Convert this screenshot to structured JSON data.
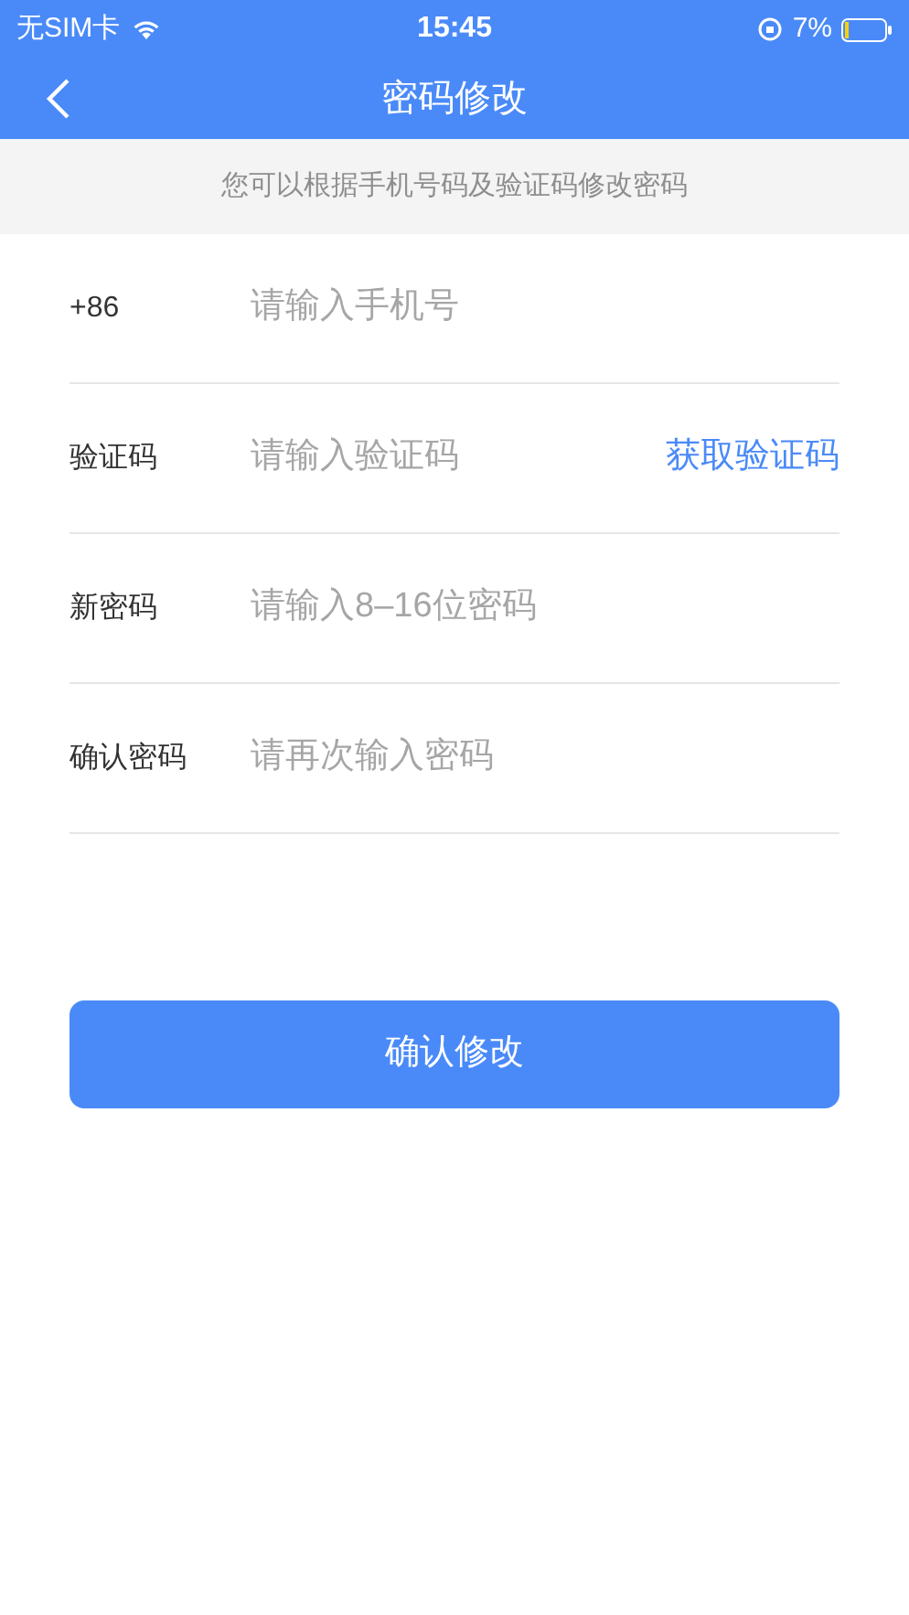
{
  "status_bar": {
    "carrier": "无SIM卡",
    "time": "15:45",
    "battery": "7%"
  },
  "nav": {
    "title": "密码修改"
  },
  "hint": "您可以根据手机号码及验证码修改密码",
  "fields": [
    {
      "kind": "plain",
      "label": "+86",
      "placeholder": "请输入手机号"
    },
    {
      "kind": "code",
      "label": "验证码",
      "placeholder": "请输入验证码",
      "action": "获取验证码"
    },
    {
      "kind": "plain",
      "label": "新密码",
      "placeholder": "请输入8–16位密码"
    },
    {
      "kind": "plain",
      "label": "确认密码",
      "placeholder": "请再次输入密码"
    }
  ],
  "submit": "确认修改"
}
